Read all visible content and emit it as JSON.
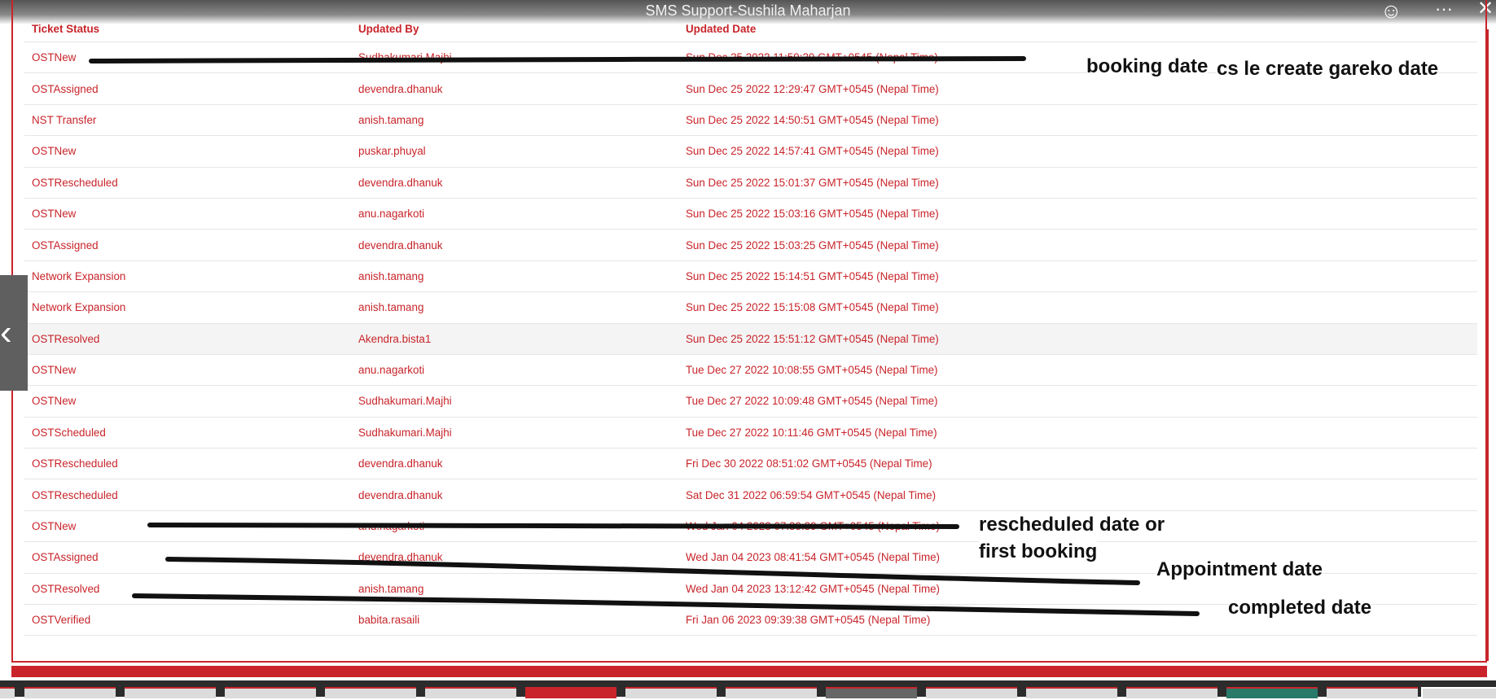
{
  "viewer": {
    "title": "SMS Support-Sushila Maharjan",
    "emoji_icon": "smiley-icon",
    "more_icon": "more-options-icon",
    "close_icon": "close-icon",
    "prev_icon": "chevron-left-icon"
  },
  "table": {
    "headers": [
      "Ticket Status",
      "Updated By",
      "Updated Date"
    ],
    "rows": [
      [
        "OSTNew",
        "Sudhakumari.Majhi",
        "Sun Dec 25 2022 11:59:29 GMT+0545 (Nepal Time)"
      ],
      [
        "OSTAssigned",
        "devendra.dhanuk",
        "Sun Dec 25 2022 12:29:47 GMT+0545 (Nepal Time)"
      ],
      [
        "NST Transfer",
        "anish.tamang",
        "Sun Dec 25 2022 14:50:51 GMT+0545 (Nepal Time)"
      ],
      [
        "OSTNew",
        "puskar.phuyal",
        "Sun Dec 25 2022 14:57:41 GMT+0545 (Nepal Time)"
      ],
      [
        "OSTRescheduled",
        "devendra.dhanuk",
        "Sun Dec 25 2022 15:01:37 GMT+0545 (Nepal Time)"
      ],
      [
        "OSTNew",
        "anu.nagarkoti",
        "Sun Dec 25 2022 15:03:16 GMT+0545 (Nepal Time)"
      ],
      [
        "OSTAssigned",
        "devendra.dhanuk",
        "Sun Dec 25 2022 15:03:25 GMT+0545 (Nepal Time)"
      ],
      [
        "Network Expansion",
        "anish.tamang",
        "Sun Dec 25 2022 15:14:51 GMT+0545 (Nepal Time)"
      ],
      [
        "Network Expansion",
        "anish.tamang",
        "Sun Dec 25 2022 15:15:08 GMT+0545 (Nepal Time)"
      ],
      [
        "OSTResolved",
        "Akendra.bista1",
        "Sun Dec 25 2022 15:51:12 GMT+0545 (Nepal Time)"
      ],
      [
        "OSTNew",
        "anu.nagarkoti",
        "Tue Dec 27 2022 10:08:55 GMT+0545 (Nepal Time)"
      ],
      [
        "OSTNew",
        "Sudhakumari.Majhi",
        "Tue Dec 27 2022 10:09:48 GMT+0545 (Nepal Time)"
      ],
      [
        "OSTScheduled",
        "Sudhakumari.Majhi",
        "Tue Dec 27 2022 10:11:46 GMT+0545 (Nepal Time)"
      ],
      [
        "OSTRescheduled",
        "devendra.dhanuk",
        "Fri Dec 30 2022 08:51:02 GMT+0545 (Nepal Time)"
      ],
      [
        "OSTRescheduled",
        "devendra.dhanuk",
        "Sat Dec 31 2022 06:59:54 GMT+0545 (Nepal Time)"
      ],
      [
        "OSTNew",
        "anu.nagarkoti",
        "Wed Jan 04 2023 07:39:39 GMT+0545 (Nepal Time)"
      ],
      [
        "OSTAssigned",
        "devendra.dhanuk",
        "Wed Jan 04 2023 08:41:54 GMT+0545 (Nepal Time)"
      ],
      [
        "OSTResolved",
        "anish.tamang",
        "Wed Jan 04 2023 13:12:42 GMT+0545 (Nepal Time)"
      ],
      [
        "OSTVerified",
        "babita.rasaili",
        "Fri Jan 06 2023 09:39:38 GMT+0545 (Nepal Time)"
      ]
    ]
  },
  "annotations": {
    "booking": "booking date",
    "cs_create": "cs le create gareko date",
    "rescheduled_line1": "rescheduled date or",
    "rescheduled_line2": "first booking",
    "appointment": "Appointment date",
    "completed": "completed date"
  },
  "colors": {
    "accent": "#c8242a",
    "annotation_ink": "#111111"
  }
}
